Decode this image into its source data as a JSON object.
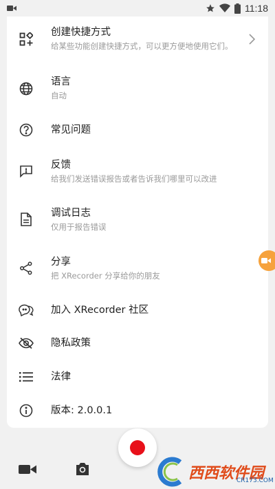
{
  "status": {
    "time": "11:18"
  },
  "menu": [
    {
      "title": "创建快捷方式",
      "subtitle": "给某些功能创建快捷方式，可以更方便地使用它们。",
      "icon": "shortcut-grid-icon"
    },
    {
      "title": "语言",
      "subtitle": "自动",
      "icon": "globe-icon"
    },
    {
      "title": "常见问题",
      "subtitle": "",
      "icon": "help-circle-icon"
    },
    {
      "title": "反馈",
      "subtitle": "给我们发送错误报告或者告诉我们哪里可以改进",
      "icon": "feedback-icon"
    },
    {
      "title": "调试日志",
      "subtitle": "仅用于报告错误",
      "icon": "document-icon"
    },
    {
      "title": "分享",
      "subtitle": "把 XRecorder 分享给你的朋友",
      "icon": "share-icon"
    },
    {
      "title": "加入 XRecorder 社区",
      "subtitle": "",
      "icon": "community-chat-icon"
    },
    {
      "title": "隐私政策",
      "subtitle": "",
      "icon": "eye-off-icon"
    },
    {
      "title": "法律",
      "subtitle": "",
      "icon": "list-icon"
    },
    {
      "title": "版本: 2.0.0.1",
      "subtitle": "",
      "icon": "info-icon"
    }
  ],
  "watermark": {
    "brand": "西西软件园",
    "site": "CR173.COM"
  },
  "colors": {
    "record": "#e8101a",
    "floating": "#f6a23c"
  }
}
